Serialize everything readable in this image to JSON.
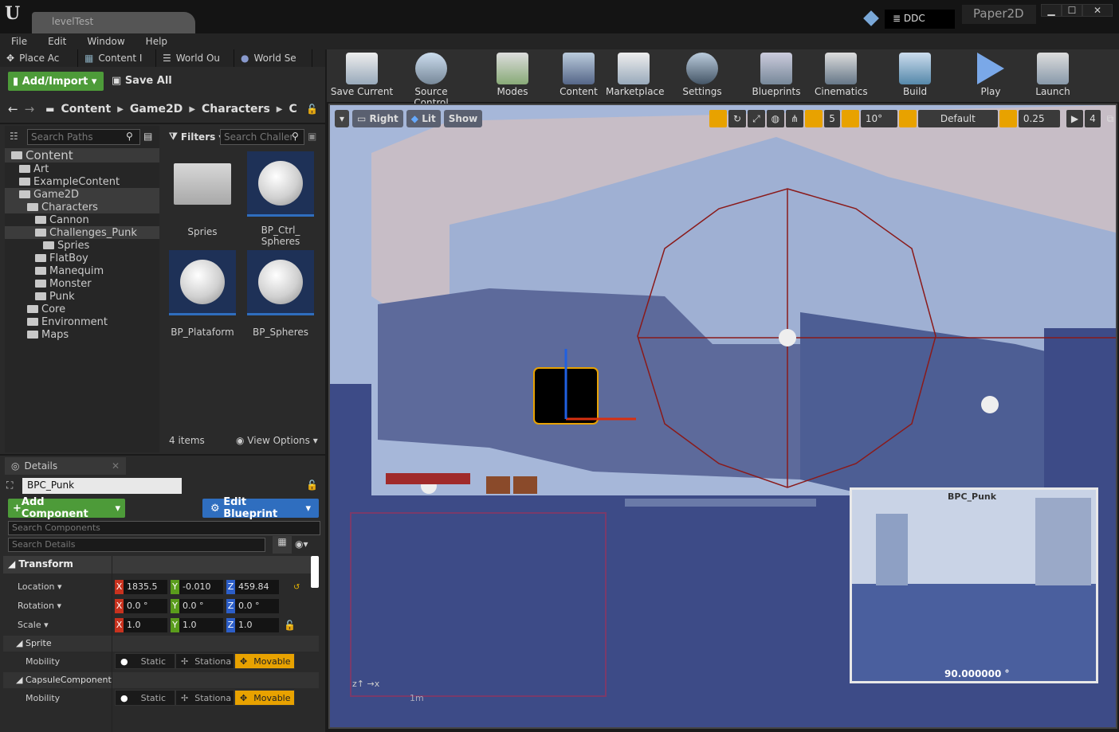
{
  "window": {
    "tab_title": "levelTest",
    "ddc": "DDC",
    "project": "Paper2D",
    "minimize": "▁",
    "maximize": "☐",
    "close": "✕"
  },
  "menu": [
    "File",
    "Edit",
    "Window",
    "Help"
  ],
  "mode_tabs": [
    "Place Ac",
    "Content I",
    "World Ou",
    "World Se"
  ],
  "content_browser": {
    "add_import": "Add/Import",
    "save_all": "Save All",
    "breadcrumb": [
      "Content",
      "Game2D",
      "Characters",
      "C"
    ],
    "search_paths": "Search Paths",
    "filters": "Filters",
    "search_challenges": "Search Challer",
    "tree": [
      {
        "label": "Content",
        "indent": 0
      },
      {
        "label": "Art",
        "indent": 1
      },
      {
        "label": "ExampleContent",
        "indent": 1
      },
      {
        "label": "Game2D",
        "indent": 1
      },
      {
        "label": "Characters",
        "indent": 2
      },
      {
        "label": "Cannon",
        "indent": 3
      },
      {
        "label": "Challenges_Punk",
        "indent": 3
      },
      {
        "label": "Spries",
        "indent": 4
      },
      {
        "label": "FlatBoy",
        "indent": 3
      },
      {
        "label": "Manequim",
        "indent": 3
      },
      {
        "label": "Monster",
        "indent": 3
      },
      {
        "label": "Punk",
        "indent": 3
      },
      {
        "label": "Core",
        "indent": 2
      },
      {
        "label": "Environment",
        "indent": 2
      },
      {
        "label": "Maps",
        "indent": 2
      }
    ],
    "assets": [
      "Spries",
      "BP_Ctrl_ Spheres",
      "BP_Plataform",
      "BP_Spheres"
    ],
    "item_count": "4 items",
    "view_options": "View Options"
  },
  "details": {
    "tab": "Details",
    "name": "BPC_Punk",
    "add_component": "Add Component",
    "edit_blueprint": "Edit Blueprint",
    "search_components": "Search Components",
    "search_details": "Search Details",
    "transform": "Transform",
    "location": {
      "label": "Location",
      "x": "1835.5",
      "y": "-0.010",
      "z": "459.84"
    },
    "rotation": {
      "label": "Rotation",
      "x": "0.0 °",
      "y": "0.0 °",
      "z": "0.0 °"
    },
    "scale": {
      "label": "Scale",
      "x": "1.0",
      "y": "1.0",
      "z": "1.0"
    },
    "sprite": "Sprite",
    "capsule": "CapsuleComponent",
    "mobility": "Mobility",
    "static": "Static",
    "stationary": "Stationa",
    "movable": "Movable"
  },
  "toolbar": [
    "Save Current",
    "Source Control",
    "Modes",
    "Content",
    "Marketplace",
    "Settings",
    "Blueprints",
    "Cinematics",
    "Build",
    "Play",
    "Launch"
  ],
  "viewport": {
    "view": "Right",
    "lit": "Lit",
    "show": "Show",
    "grid": "5",
    "angle": "10°",
    "scale_mode": "Default",
    "scale_snap": "0.25",
    "cam_speed": "4",
    "scale_label": "1m",
    "preview_title": "BPC_Punk",
    "preview_angle": "90.000000 °"
  }
}
